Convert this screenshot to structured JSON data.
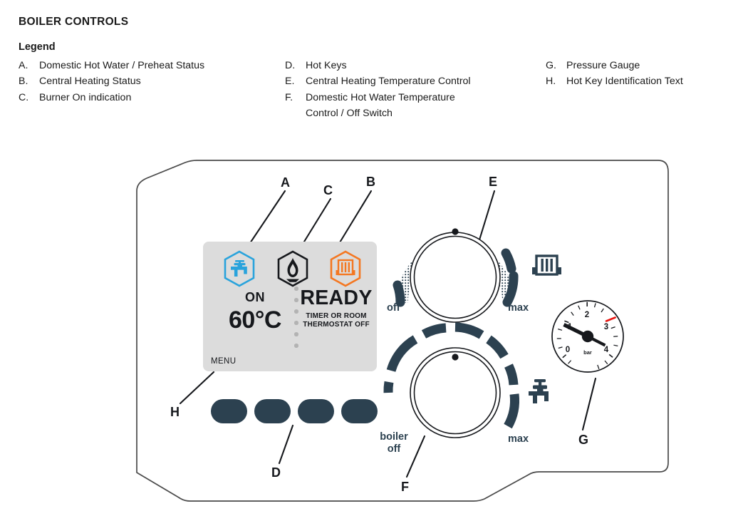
{
  "header": {
    "title": "BOILER CONTROLS",
    "legend_title": "Legend"
  },
  "legend": {
    "column1": [
      {
        "key": "A.",
        "text": "Domestic Hot Water / Preheat Status"
      },
      {
        "key": "B.",
        "text": "Central Heating Status"
      },
      {
        "key": "C.",
        "text": "Burner On indication"
      }
    ],
    "column2": [
      {
        "key": "D.",
        "text": "Hot Keys"
      },
      {
        "key": "E.",
        "text": "Central Heating Temperature Control"
      },
      {
        "key": "F.",
        "text": "Domestic Hot Water Temperature"
      }
    ],
    "column2_continuation": "Control / Off Switch",
    "column3": [
      {
        "key": "G.",
        "text": "Pressure Gauge"
      },
      {
        "key": "H.",
        "text": "Hot Key Identification Text"
      }
    ]
  },
  "callouts": {
    "a": "A",
    "b": "B",
    "c": "C",
    "d": "D",
    "e": "E",
    "f": "F",
    "g": "G",
    "h": "H"
  },
  "lcd": {
    "dhw_status": "ON",
    "dhw_temperature": "60°C",
    "ch_status": "READY",
    "ch_substatus_line1": "TIMER OR ROOM",
    "ch_substatus_line2": "THERMOSTAT OFF",
    "menu_label": "MENU",
    "icons": {
      "dhw": "tap-icon",
      "burner": "flame-icon",
      "central_heating": "radiator-icon"
    },
    "colors": {
      "background": "#dcdcdc",
      "dhw_icon": "#29a3dc",
      "burner_icon": "#16181c",
      "ch_icon": "#f47721",
      "text": "#16181c",
      "divider_dot": "#b3b3b3"
    }
  },
  "hot_keys": {
    "count": 4,
    "color": "#2c4150"
  },
  "ch_knob": {
    "label_min": "off",
    "label_max": "max",
    "side_icon": "radiator-icon",
    "pointer_angle_deg": 0
  },
  "dhw_knob": {
    "label_min_line1": "boiler",
    "label_min_line2": "off",
    "label_max": "max",
    "side_icon": "tap-icon",
    "pointer_angle_deg": 0
  },
  "pressure_gauge": {
    "unit": "bar",
    "ticks": [
      "0",
      "1",
      "2",
      "3",
      "4"
    ],
    "min": 0,
    "max": 4,
    "needle_value": 1.2,
    "red_mark_value": 3.1,
    "red_mark_color": "#e8130e"
  },
  "colors": {
    "accent_dark": "#2c4150",
    "panel_outline": "#4a4a4a",
    "text": "#16181c"
  }
}
